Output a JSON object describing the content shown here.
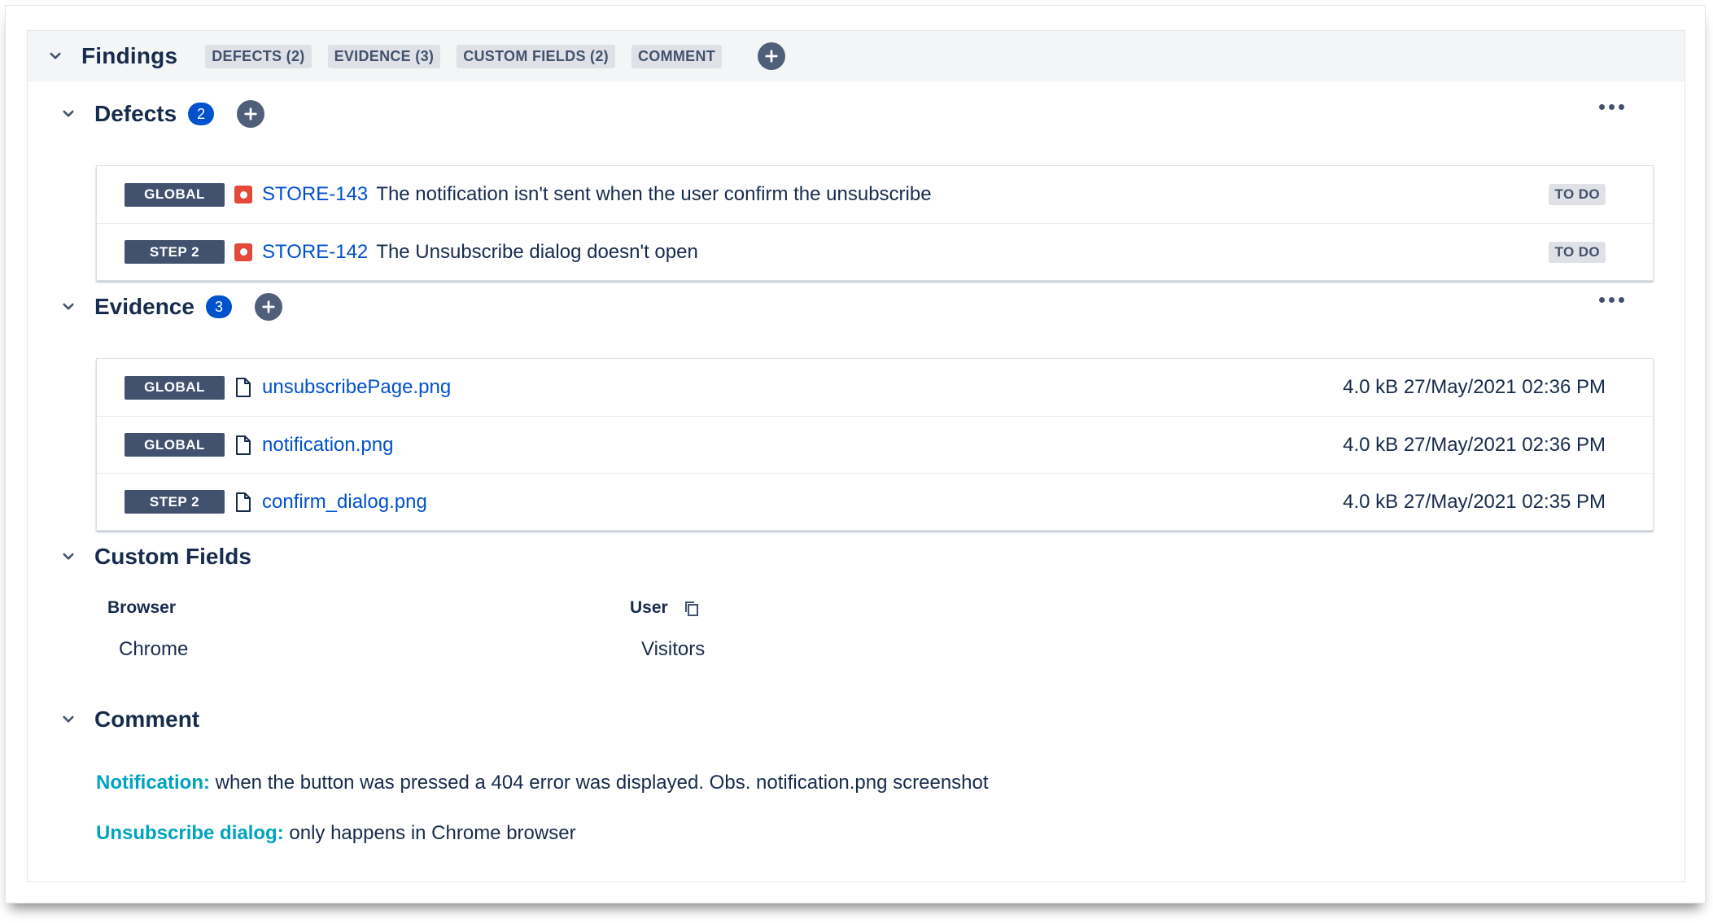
{
  "findings": {
    "title": "Findings",
    "chips": [
      "DEFECTS (2)",
      "EVIDENCE (3)",
      "CUSTOM FIELDS (2)",
      "COMMENT"
    ]
  },
  "defects": {
    "title": "Defects",
    "count": "2",
    "rows": [
      {
        "tag": "GLOBAL",
        "key": "STORE-143",
        "summary": "The notification isn't sent when the user confirm the unsubscribe",
        "status": "TO DO"
      },
      {
        "tag": "STEP 2",
        "key": "STORE-142",
        "summary": "The Unsubscribe dialog doesn't open",
        "status": "TO DO"
      }
    ]
  },
  "evidence": {
    "title": "Evidence",
    "count": "3",
    "rows": [
      {
        "tag": "GLOBAL",
        "file": "unsubscribePage.png",
        "meta": "4.0 kB 27/May/2021 02:36 PM"
      },
      {
        "tag": "GLOBAL",
        "file": "notification.png",
        "meta": "4.0 kB 27/May/2021 02:36 PM"
      },
      {
        "tag": "STEP 2",
        "file": "confirm_dialog.png",
        "meta": "4.0 kB 27/May/2021 02:35 PM"
      }
    ]
  },
  "custom_fields": {
    "title": "Custom Fields",
    "fields": [
      {
        "label": "Browser",
        "value": "Chrome"
      },
      {
        "label": "User",
        "value": "Visitors"
      }
    ]
  },
  "comment": {
    "title": "Comment",
    "lines": [
      {
        "label": "Notification:",
        "text": " when the button was pressed a 404 error was displayed. Obs. notification.png screenshot"
      },
      {
        "label": "Unsubscribe dialog:",
        "text": " only happens in Chrome browser"
      }
    ]
  },
  "icons": {
    "chevron": "chevron-down-icon",
    "add": "plus-icon",
    "more": "more-icon",
    "bug": "bug-icon",
    "file": "file-icon",
    "copy": "copy-icon"
  },
  "colors": {
    "link": "#0052cc",
    "count_badge": "#0052cc",
    "tag": "#42526e",
    "bug": "#e5493a",
    "comment_label": "#00a3bf"
  }
}
